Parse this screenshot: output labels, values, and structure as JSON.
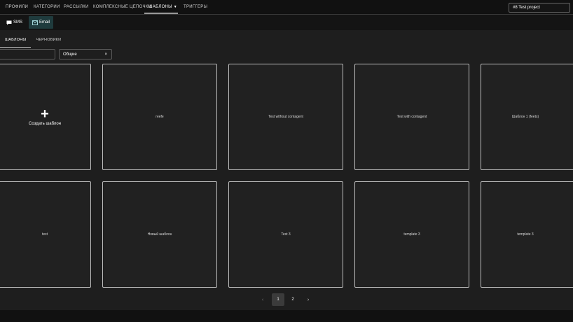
{
  "nav": {
    "items": [
      "ПРОФИЛИ",
      "КАТЕГОРИИ",
      "РАССЫЛКИ",
      "КОМПЛЕКСНЫЕ ЦЕПОЧКИ",
      "ШАБЛОНЫ",
      "ТРИГГЕРЫ"
    ],
    "active_index": 4,
    "project_label": "#8 Test project"
  },
  "channels": {
    "sms_label": "SMS",
    "email_label": "Email"
  },
  "tabs": [
    "ШАБЛОНЫ",
    "ЧЕРНОВИКИ"
  ],
  "filters": {
    "search_value": "",
    "category_value": "Общие",
    "category_clear": "×"
  },
  "create_card": {
    "plus": "+",
    "label": "Создать шаблон"
  },
  "templates": [
    "reefe",
    "Test without contagent",
    "Test with contagent",
    "Шаблон 1 (feets)",
    "test",
    "Новый шаблон",
    "Test 3",
    "template 3",
    "template 3"
  ],
  "pagination": {
    "prev": "‹",
    "pages": [
      "1",
      "2"
    ],
    "current": "1",
    "next": "›"
  },
  "colors": {
    "background": "#1e1e1e",
    "topbar": "#111111",
    "card_border": "#bdbdbd",
    "email_button": "#1f3b3d"
  }
}
